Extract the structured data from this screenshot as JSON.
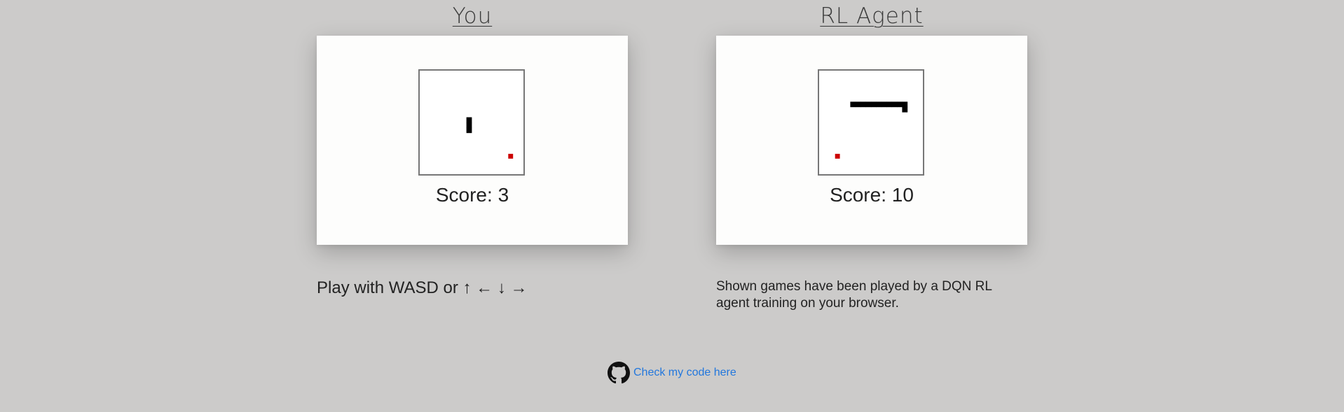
{
  "human": {
    "title": "You",
    "score_label": "Score: 3",
    "score": 3,
    "snake_segments": [
      [
        9,
        9
      ],
      [
        9,
        10
      ],
      [
        9,
        11
      ]
    ],
    "food": [
      17,
      16
    ]
  },
  "agent": {
    "title": "RL Agent",
    "score_label": "Score: 10",
    "score": 10,
    "snake_segments": [
      [
        6,
        6
      ],
      [
        7,
        6
      ],
      [
        8,
        6
      ],
      [
        9,
        6
      ],
      [
        10,
        6
      ],
      [
        11,
        6
      ],
      [
        12,
        6
      ],
      [
        13,
        6
      ],
      [
        14,
        6
      ],
      [
        15,
        6
      ],
      [
        16,
        6
      ],
      [
        16,
        7
      ]
    ],
    "food": [
      3,
      16
    ]
  },
  "board": {
    "grid_cells": 20,
    "border_color": "#777777",
    "background": "#ffffff",
    "snake_color": "#000000",
    "food_color": "#cc0000"
  },
  "instructions": {
    "text": "Play with WASD or ↑ ← ↓ →"
  },
  "agent_note": {
    "text": "Shown games have been played by a DQN RL agent training on your browser."
  },
  "footer": {
    "link_text": "Check my code here",
    "icon": "github-icon",
    "link_color": "#2277dd"
  },
  "colors": {
    "page_background": "#cccbca",
    "card_background": "#fdfdfc"
  }
}
